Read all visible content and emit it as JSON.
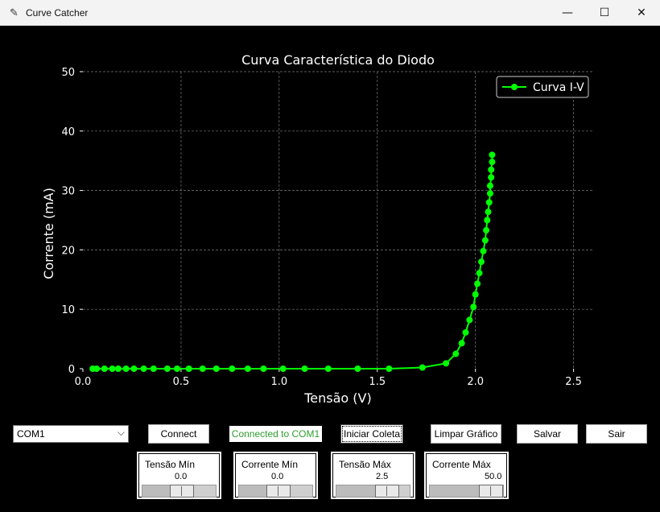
{
  "window": {
    "title": "Curve Catcher",
    "icon": "feather-icon",
    "minimize": "—",
    "maximize": "☐",
    "close": "✕"
  },
  "chart_data": {
    "type": "line",
    "title": "Curva Característica do Diodo",
    "xlabel": "Tensão (V)",
    "ylabel": "Corrente (mA)",
    "xlim": [
      0.0,
      2.6
    ],
    "ylim": [
      0,
      50
    ],
    "xticks": [
      "0.0",
      "0.5",
      "1.0",
      "1.5",
      "2.0",
      "2.5"
    ],
    "yticks": [
      "0",
      "10",
      "20",
      "30",
      "40",
      "50"
    ],
    "grid": true,
    "legend": "top-right",
    "background": "#000000",
    "color": "#00ff00",
    "series": [
      {
        "name": "Curva I-V",
        "x": [
          0.05,
          0.07,
          0.11,
          0.15,
          0.18,
          0.22,
          0.26,
          0.31,
          0.36,
          0.43,
          0.48,
          0.54,
          0.61,
          0.68,
          0.76,
          0.84,
          0.92,
          1.02,
          1.13,
          1.25,
          1.4,
          1.56,
          1.73,
          1.85,
          1.9,
          1.93,
          1.95,
          1.97,
          1.99,
          2.0,
          2.01,
          2.02,
          2.03,
          2.04,
          2.05,
          2.055,
          2.06,
          2.065,
          2.07,
          2.075,
          2.075,
          2.08,
          2.08,
          2.085,
          2.085
        ],
        "y": [
          0,
          0,
          0,
          0,
          0,
          0,
          0,
          0,
          0,
          0,
          0,
          0,
          0,
          0,
          0,
          0,
          0,
          0,
          0,
          0,
          0,
          0,
          0.2,
          0.9,
          2.5,
          4.3,
          6.1,
          8.2,
          10.4,
          12.5,
          14.3,
          16.1,
          18.0,
          19.8,
          21.6,
          23.3,
          25.0,
          26.4,
          28.0,
          29.5,
          30.8,
          32.2,
          33.5,
          34.8,
          36.0
        ]
      }
    ]
  },
  "controls": {
    "port_value": "COM1",
    "connect_label": "Connect",
    "status_text": "Connected to COM1",
    "start_label": "Iniciar Coleta",
    "clear_label": "Limpar Gráfico",
    "save_label": "Salvar",
    "exit_label": "Sair",
    "status_color": "#2e9e2e"
  },
  "sliders": [
    {
      "label": "Tensão Mín",
      "value": "0.0",
      "fraction": 0.0
    },
    {
      "label": "Corrente Mín",
      "value": "0.0",
      "fraction": 0.0
    },
    {
      "label": "Tensão Máx",
      "value": "2.5",
      "fraction": 0.5
    },
    {
      "label": "Corrente Máx",
      "value": "50.0",
      "fraction": 1.0
    }
  ]
}
